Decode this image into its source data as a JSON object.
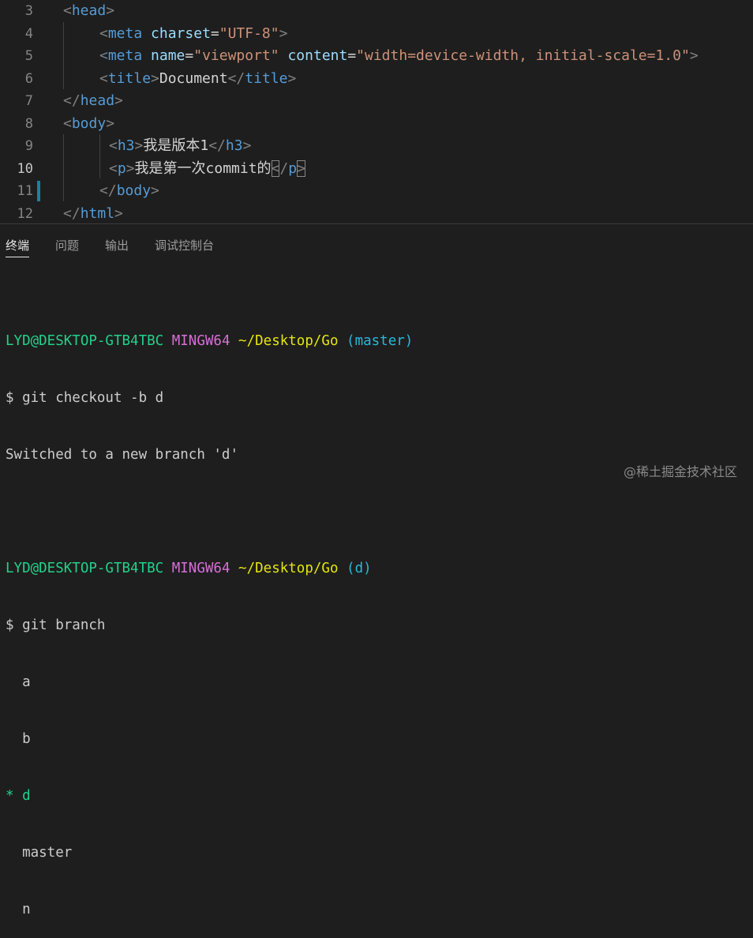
{
  "editor": {
    "lines": [
      {
        "num": "3",
        "parts": [
          {
            "t": "<",
            "c": "br"
          },
          {
            "t": "head",
            "c": "tag"
          },
          {
            "t": ">",
            "c": "br"
          }
        ]
      },
      {
        "num": "4",
        "parts": [
          {
            "t": "<",
            "c": "br"
          },
          {
            "t": "meta",
            "c": "tag"
          },
          {
            "t": " "
          },
          {
            "t": "charset",
            "c": "attr"
          },
          {
            "t": "="
          },
          {
            "t": "\"UTF-8\"",
            "c": "str"
          },
          {
            "t": ">",
            "c": "br"
          }
        ]
      },
      {
        "num": "5",
        "parts": [
          {
            "t": "<",
            "c": "br"
          },
          {
            "t": "meta",
            "c": "tag"
          },
          {
            "t": " "
          },
          {
            "t": "name",
            "c": "attr"
          },
          {
            "t": "="
          },
          {
            "t": "\"viewport\"",
            "c": "str"
          },
          {
            "t": " "
          },
          {
            "t": "content",
            "c": "attr"
          },
          {
            "t": "="
          },
          {
            "t": "\"width=device-width, initial-scale=1.0\"",
            "c": "str"
          },
          {
            "t": ">",
            "c": "br"
          }
        ]
      },
      {
        "num": "6",
        "parts": [
          {
            "t": "<",
            "c": "br"
          },
          {
            "t": "title",
            "c": "tag"
          },
          {
            "t": ">",
            "c": "br"
          },
          {
            "t": "Document",
            "c": "txt"
          },
          {
            "t": "</",
            "c": "br"
          },
          {
            "t": "title",
            "c": "tag"
          },
          {
            "t": ">",
            "c": "br"
          }
        ]
      },
      {
        "num": "7",
        "parts": [
          {
            "t": "</",
            "c": "br"
          },
          {
            "t": "head",
            "c": "tag"
          },
          {
            "t": ">",
            "c": "br"
          }
        ]
      },
      {
        "num": "8",
        "parts": [
          {
            "t": "<",
            "c": "br"
          },
          {
            "t": "body",
            "c": "tag"
          },
          {
            "t": ">",
            "c": "br"
          }
        ]
      },
      {
        "num": "9",
        "parts": [
          {
            "t": "<",
            "c": "br"
          },
          {
            "t": "h3",
            "c": "tag"
          },
          {
            "t": ">",
            "c": "br"
          },
          {
            "t": "我是版本1",
            "c": "txt"
          },
          {
            "t": "</",
            "c": "br"
          },
          {
            "t": "h3",
            "c": "tag"
          },
          {
            "t": ">",
            "c": "br"
          }
        ]
      },
      {
        "num": "10",
        "parts": [
          {
            "t": "<",
            "c": "br"
          },
          {
            "t": "p",
            "c": "tag"
          },
          {
            "t": ">",
            "c": "br"
          },
          {
            "t": "我是第一次commit的",
            "c": "txt"
          },
          {
            "t": "<",
            "c": "br bm"
          },
          {
            "t": "/",
            "c": "br"
          },
          {
            "t": "p",
            "c": "tag"
          },
          {
            "t": ">",
            "c": "br bm"
          }
        ]
      },
      {
        "num": "11",
        "parts": [
          {
            "t": "</",
            "c": "br"
          },
          {
            "t": "body",
            "c": "tag"
          },
          {
            "t": ">",
            "c": "br"
          }
        ]
      },
      {
        "num": "12",
        "parts": [
          {
            "t": "</",
            "c": "br"
          },
          {
            "t": "html",
            "c": "tag"
          },
          {
            "t": ">",
            "c": "br"
          }
        ]
      }
    ]
  },
  "panel": {
    "tabs": [
      "终端",
      "问题",
      "输出",
      "调试控制台"
    ],
    "active_tab": "终端"
  },
  "terminal": {
    "block1": {
      "user": "LYD@DESKTOP-GTB4TBC",
      "system": "MINGW64",
      "path": "~/Desktop/Go",
      "branch": "(master)",
      "command": "$ git checkout -b d",
      "output": "Switched to a new branch 'd'"
    },
    "block2": {
      "user": "LYD@DESKTOP-GTB4TBC",
      "system": "MINGW64",
      "path": "~/Desktop/Go",
      "branch": "(d)",
      "command": "$ git branch",
      "branches": [
        "  a",
        "  b",
        "* d",
        "  master",
        "  n"
      ]
    }
  },
  "watermark": "@稀土掘金技术社区",
  "colors": {
    "background": "#1e1e1e",
    "tag": "#569cd6",
    "attribute": "#9cdcfe",
    "string": "#ce9178",
    "user": "#23d18b",
    "system": "#d670d6",
    "path": "#e5e510",
    "branch": "#29b8db"
  }
}
